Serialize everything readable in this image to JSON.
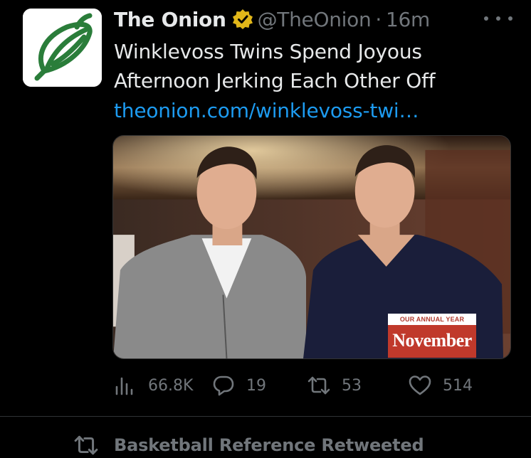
{
  "tweet": {
    "author_name": "The Onion",
    "author_handle": "@TheOnion",
    "separator": "·",
    "timestamp": "16m",
    "headline": "Winklevoss Twins Spend Joyous Afternoon Jerking Each Other Off",
    "link": "theonion.com/winklevoss-twi…",
    "avatar_icon": "onion-logo-icon",
    "verified_icon": "verified-badge-icon",
    "more_icon": "more-options-icon",
    "media": {
      "badge_top": "OUR ANNUAL YEAR",
      "badge_main": "November"
    },
    "actions": {
      "views": "66.8K",
      "replies": "19",
      "retweets": "53",
      "likes": "514"
    }
  },
  "next_item": {
    "retweeted_label": "Basketball Reference Retweeted"
  },
  "colors": {
    "background": "#000000",
    "text_primary": "#e7e9ea",
    "text_secondary": "#71767b",
    "link": "#1d9bf0",
    "verified_gold": "#e2b719",
    "onion_green": "#2a7d3a",
    "badge_red": "#c0392b"
  }
}
